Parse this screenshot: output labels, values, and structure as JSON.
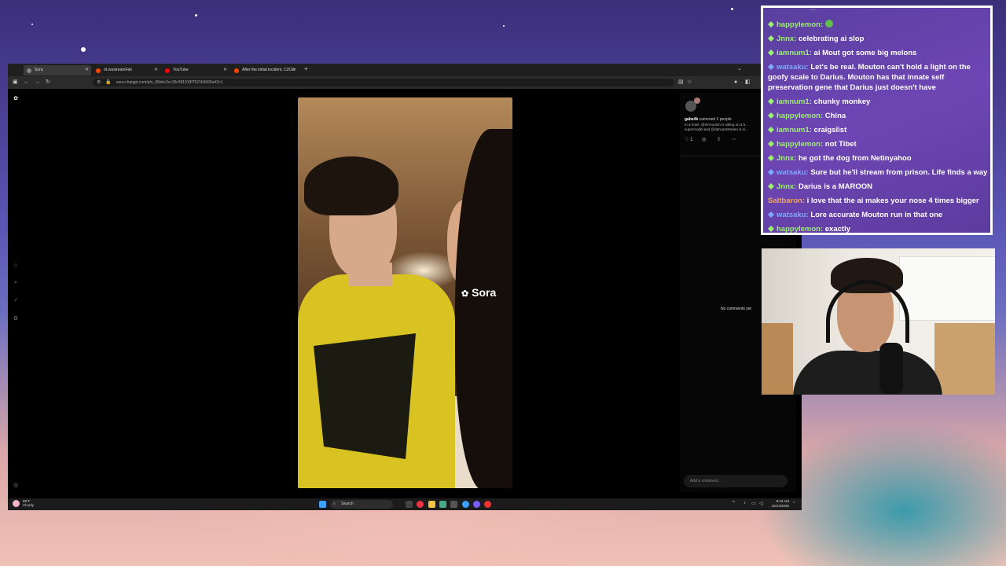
{
  "browser": {
    "tabs": [
      {
        "label": "Sora",
        "active": true
      },
      {
        "label": "r/LivestreamFail",
        "active": false
      },
      {
        "label": "YouTube",
        "active": false
      },
      {
        "label": "After the initial incident, C2Clo",
        "active": false
      }
    ],
    "url": "sora.chatgpt.com/p/s_68ebc3cc18c081919f7521b5665a42c1"
  },
  "sora": {
    "watermark": "Sora",
    "post": {
      "username": "gabe4k",
      "cameo_text": "cameoed 2 people",
      "caption": "In a hotel, @mrmouton is sitting on a b... supermodel and @dancantstream is si...",
      "like_count": "1"
    },
    "no_comments": "No comments yet",
    "comment_placeholder": "Add a comment..."
  },
  "taskbar": {
    "weather_temp": "59°F",
    "weather_desc": "Cloudy",
    "search_label": "Search",
    "time": "8:43 AM",
    "date": "10/14/2025"
  },
  "chat": {
    "partial_top": "...",
    "messages": [
      {
        "user": "happylemon",
        "text": "",
        "emote": "frog-emote",
        "badge": "green",
        "color": "green"
      },
      {
        "user": "Jnnx",
        "text": "celebrating ai slop",
        "badge": "green",
        "color": "green"
      },
      {
        "user": "iamnum1",
        "text": "ai Mout got some big melons",
        "badge": "green",
        "color": "green"
      },
      {
        "user": "watsaku",
        "text": "Let's be real. Mouton can't hold a light on the goofy scale to Darius. Mouton has that innate self preservation gene that Darius just doesn't have",
        "badge": "blue",
        "color": "blue"
      },
      {
        "user": "iamnum1",
        "text": "chunky monkey",
        "badge": "green",
        "color": "green"
      },
      {
        "user": "happylemon",
        "text": "China",
        "badge": "green",
        "color": "green"
      },
      {
        "user": "iamnum1",
        "text": "craigslist",
        "badge": "green",
        "color": "green"
      },
      {
        "user": "happylemon",
        "text": "not Tibet",
        "badge": "green",
        "color": "green"
      },
      {
        "user": "Jnnx",
        "text": "he got the dog from Netinyahoo",
        "badge": "green",
        "color": "green"
      },
      {
        "user": "watsaku",
        "text": "Sure but he'll stream from prison. Life finds a way",
        "badge": "blue",
        "color": "blue"
      },
      {
        "user": "Jnnx",
        "text": "Darius is a MAROON",
        "badge": "green",
        "color": "green"
      },
      {
        "user": "Saltbaron",
        "text": "i love that the ai makes your nose 4 times bigger",
        "badge": "none",
        "color": "orange"
      },
      {
        "user": "watsaku",
        "text": "Lore accurate Mouton run in that one",
        "badge": "blue",
        "color": "blue"
      },
      {
        "user": "happylemon",
        "text": "exactly",
        "badge": "green",
        "color": "green"
      }
    ]
  },
  "colors": {
    "chat_bg": "#6e46b4",
    "username_green": "#9cf06e",
    "username_blue": "#7ea8ff",
    "username_orange": "#f0a868"
  }
}
